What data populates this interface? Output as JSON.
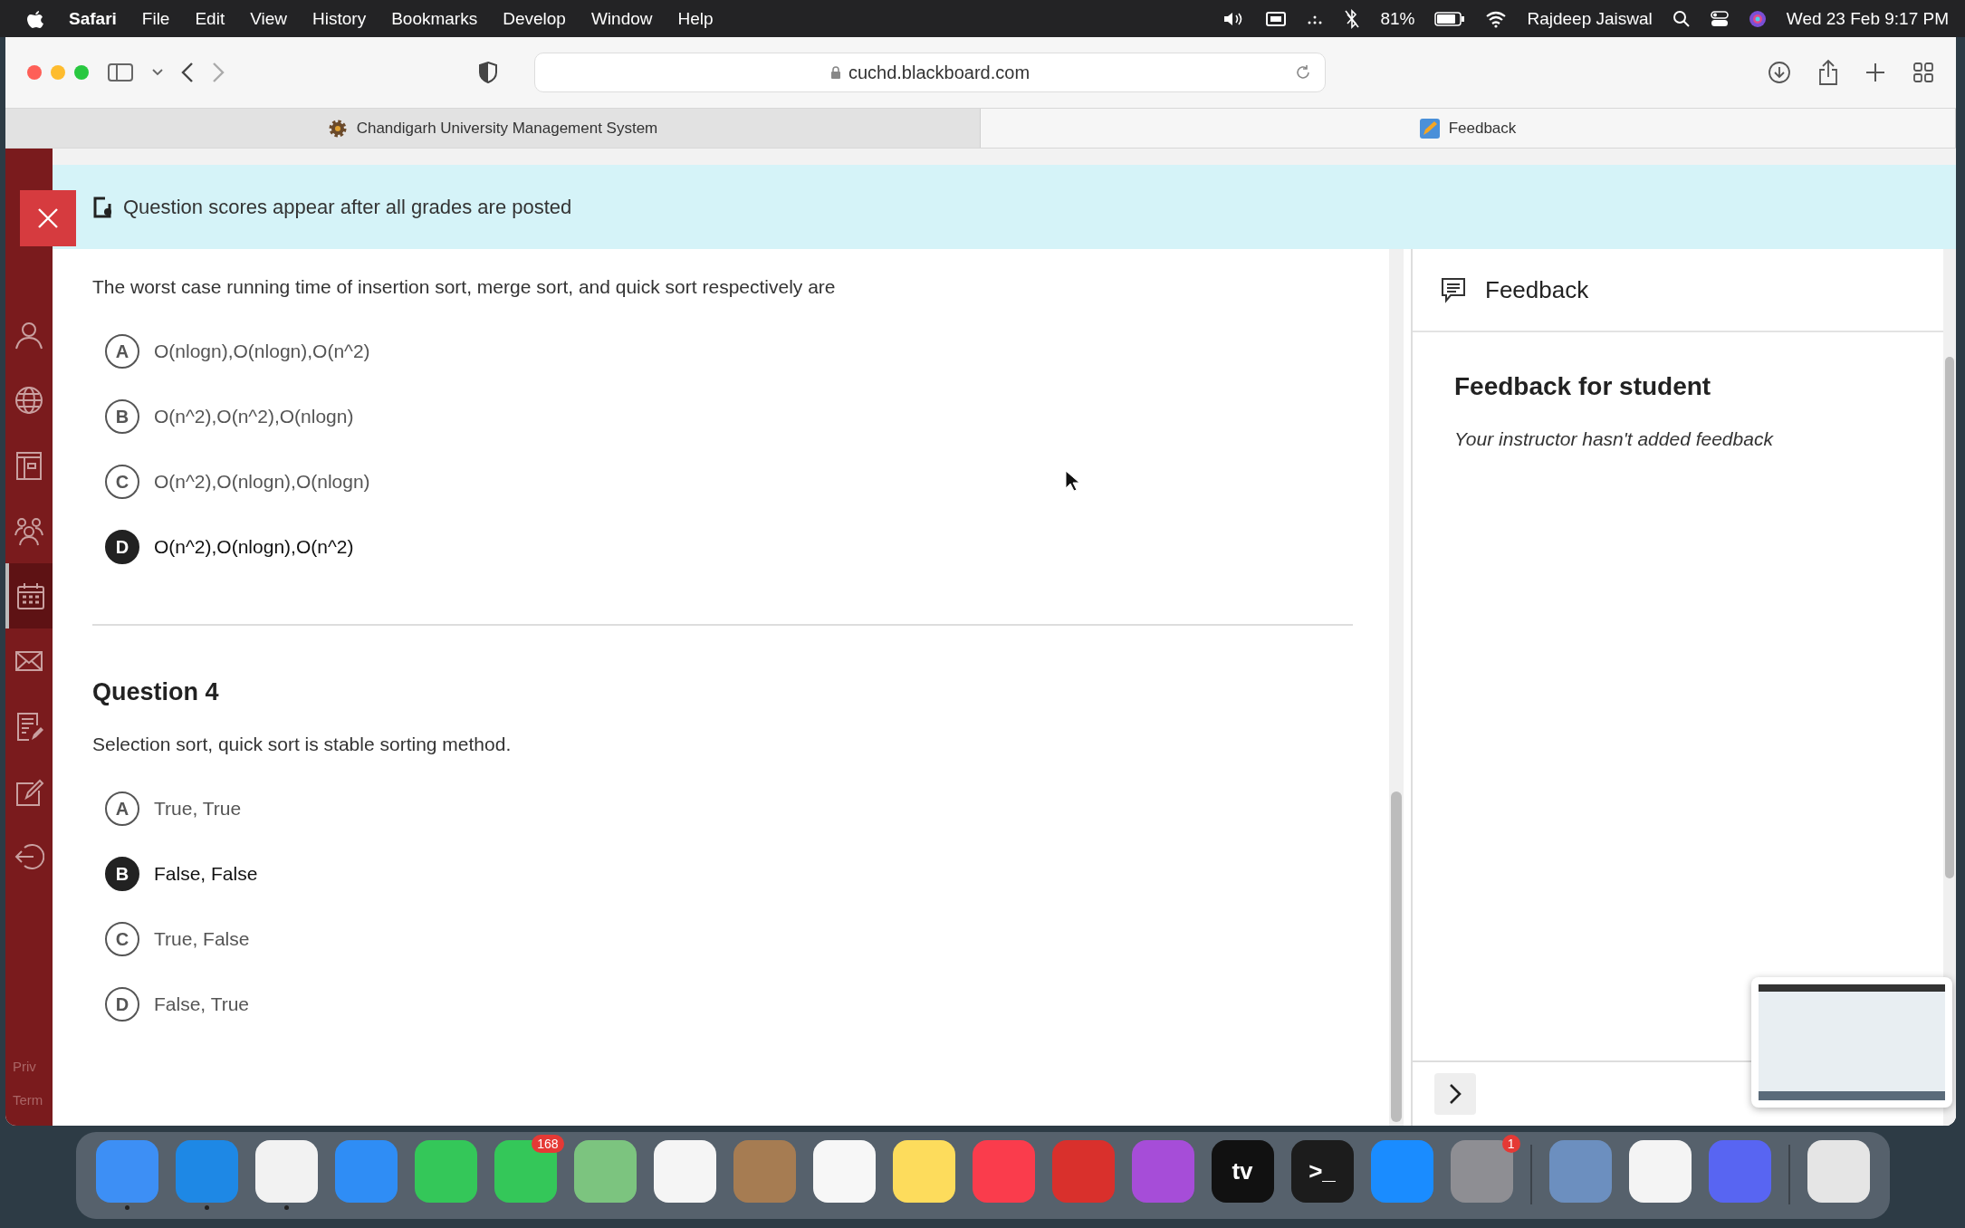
{
  "menu_bar": {
    "app": "Safari",
    "menus": [
      "File",
      "Edit",
      "View",
      "History",
      "Bookmarks",
      "Develop",
      "Window",
      "Help"
    ],
    "battery": "81%",
    "user": "Rajdeep Jaiswal",
    "clock": "Wed 23 Feb  9:17 PM"
  },
  "browser": {
    "url": "cuchd.blackboard.com",
    "tabs": [
      {
        "title": "Chandigarh University Management System",
        "selected": false
      },
      {
        "title": "Feedback",
        "selected": true
      }
    ]
  },
  "sidebar": {
    "items": [
      {
        "kind": "person",
        "selected": false
      },
      {
        "kind": "globe",
        "selected": false
      },
      {
        "kind": "book",
        "selected": false
      },
      {
        "kind": "group",
        "selected": false
      },
      {
        "kind": "calendar",
        "selected": true
      },
      {
        "kind": "mail",
        "selected": false
      },
      {
        "kind": "grades",
        "selected": false
      },
      {
        "kind": "edit",
        "selected": false
      },
      {
        "kind": "logout",
        "selected": false
      }
    ],
    "footer": [
      "Priv",
      "Term"
    ]
  },
  "banner": {
    "text": "Question scores appear after all grades are posted"
  },
  "questions": [
    {
      "prompt": "The worst case running time of insertion sort, merge sort, and quick sort respectively are",
      "options": [
        {
          "letter": "A",
          "text": "O(nlogn),O(nlogn),O(n^2)",
          "selected": false
        },
        {
          "letter": "B",
          "text": "O(n^2),O(n^2),O(nlogn)",
          "selected": false
        },
        {
          "letter": "C",
          "text": "O(n^2),O(nlogn),O(nlogn)",
          "selected": false
        },
        {
          "letter": "D",
          "text": "O(n^2),O(nlogn),O(n^2)",
          "selected": true
        }
      ]
    },
    {
      "title": "Question 4",
      "prompt": "Selection sort, quick sort is stable sorting method.",
      "options": [
        {
          "letter": "A",
          "text": "True, True",
          "selected": false
        },
        {
          "letter": "B",
          "text": "False, False",
          "selected": true
        },
        {
          "letter": "C",
          "text": "True, False",
          "selected": false
        },
        {
          "letter": "D",
          "text": "False, True",
          "selected": false
        }
      ]
    }
  ],
  "feedback": {
    "header": "Feedback",
    "heading": "Feedback for student",
    "message": "Your instructor hasn't added feedback"
  },
  "dock": [
    {
      "color": "#3d8ff5",
      "running": true
    },
    {
      "color": "#1e88e5",
      "running": true
    },
    {
      "color": "#f2f2f2",
      "running": true
    },
    {
      "color": "#2f8df5",
      "running": false
    },
    {
      "color": "#34c759",
      "running": false
    },
    {
      "color": "#34c759",
      "running": false,
      "badge": "168"
    },
    {
      "color": "#7cc47f",
      "running": false
    },
    {
      "color": "#f5f5f5",
      "running": false
    },
    {
      "color": "#a67c52",
      "running": false
    },
    {
      "color": "#f7f7f7",
      "running": false
    },
    {
      "color": "#fddc5c",
      "running": false
    },
    {
      "color": "#fa3c4c",
      "running": false
    },
    {
      "color": "#d9302c",
      "running": false
    },
    {
      "color": "#a64dd8",
      "running": false
    },
    {
      "color": "#111111",
      "running": false,
      "label": "tv"
    },
    {
      "color": "#1c1c1c",
      "running": false,
      "label": ">_"
    },
    {
      "color": "#1a8cff",
      "running": false
    },
    {
      "color": "#8e8e93",
      "running": false,
      "badge": "1"
    },
    {
      "separator": true,
      "color": "#6c8fbf",
      "running": false
    },
    {
      "color": "#f4f4f4",
      "running": false
    },
    {
      "color": "#5865f2",
      "running": false
    },
    {
      "separator": true,
      "color": "#e5e5e5",
      "running": false
    }
  ]
}
